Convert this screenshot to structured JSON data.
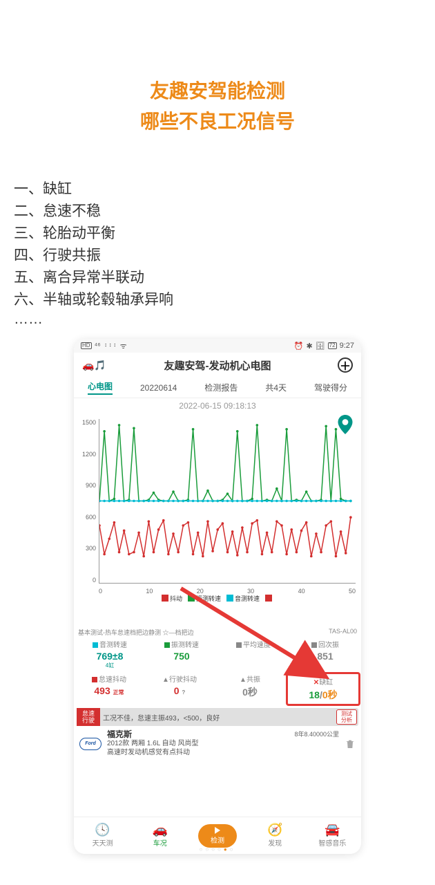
{
  "header": {
    "line1": "友趣安驾能检测",
    "line2": "哪些不良工况信号"
  },
  "items": [
    "一、缺缸",
    "二、怠速不稳",
    "三、轮胎动平衡",
    "四、行驶共振",
    "五、离合异常半联动",
    "六、半轴或轮毂轴承异响"
  ],
  "ellipsis": "……",
  "statusbar": {
    "left": "HD ⁴⁶ ⋮⋮⋮ ᯤ",
    "right": "⏰ ✱ 📶 🔋72 9:27"
  },
  "app": {
    "title": "友趣安驾-发动机心电图"
  },
  "tabs": {
    "t1": "心电图",
    "t2": "20220614",
    "t3": "检测报告",
    "t4": "共4天",
    "t5": "驾驶得分"
  },
  "timestamp": "2022-06-15 09:18:13",
  "chart_data": {
    "type": "line",
    "title": "",
    "xlabel": "",
    "ylabel": "",
    "ylim": [
      0,
      1600
    ],
    "xlim": [
      0,
      52
    ],
    "y_ticks": [
      0,
      300,
      600,
      900,
      1200,
      1500
    ],
    "x_ticks": [
      0,
      10,
      20,
      30,
      40,
      50
    ],
    "series": [
      {
        "name": "抖动",
        "color": "#d32f2f",
        "values": [
          560,
          280,
          430,
          590,
          300,
          510,
          280,
          300,
          490,
          260,
          600,
          300,
          520,
          610,
          280,
          480,
          300,
          560,
          590,
          280,
          490,
          260,
          600,
          310,
          520,
          580,
          300,
          500,
          270,
          540,
          300,
          580,
          610,
          280,
          490,
          300,
          600,
          560,
          280,
          520,
          300,
          510,
          590,
          260,
          480,
          300,
          560,
          600,
          260,
          500,
          290,
          640
        ]
      },
      {
        "name": "振测转速",
        "color": "#1a9c3b",
        "values": [
          800,
          1480,
          800,
          820,
          1540,
          800,
          810,
          1510,
          800,
          800,
          810,
          880,
          810,
          800,
          800,
          890,
          800,
          800,
          810,
          1500,
          800,
          800,
          900,
          800,
          800,
          810,
          870,
          800,
          1480,
          800,
          800,
          820,
          1540,
          800,
          810,
          800,
          920,
          800,
          1500,
          800,
          810,
          800,
          890,
          800,
          800,
          810,
          1530,
          800,
          1500,
          820,
          800,
          800
        ]
      },
      {
        "name": "音测转速",
        "color": "#00bcd4",
        "values": [
          800,
          800,
          800,
          800,
          800,
          800,
          800,
          800,
          800,
          800,
          800,
          800,
          800,
          800,
          800,
          800,
          800,
          800,
          800,
          800,
          800,
          800,
          800,
          800,
          800,
          800,
          800,
          800,
          800,
          800,
          800,
          800,
          800,
          800,
          800,
          800,
          800,
          800,
          800,
          800,
          800,
          800,
          800,
          800,
          800,
          800,
          800,
          800,
          800,
          800,
          800,
          800
        ]
      }
    ],
    "legend": [
      {
        "name": "抖动",
        "color": "#d32f2f"
      },
      {
        "name": "振测转速",
        "color": "#1a9c3b"
      },
      {
        "name": "音测转速",
        "color": "#00bcd4"
      },
      {
        "name": "",
        "color": "#d32f2f"
      }
    ]
  },
  "subnote": {
    "left": "基本测试-热车怠速档把边静测 ☆—档把边",
    "right": "TAS-AL00"
  },
  "metrics": {
    "r1": [
      {
        "lbl": "音测转速",
        "icon": "#00bcd4",
        "val": "769±8",
        "sub": "4缸",
        "valCls": "teal",
        "subCls": "teal"
      },
      {
        "lbl": "振测转速",
        "icon": "#1a9c3b",
        "val": "750",
        "sub": "",
        "valCls": "green"
      },
      {
        "lbl": "平均速度",
        "icon": "#888",
        "val": "",
        "sub": ""
      },
      {
        "lbl": "次振",
        "icon": "#888",
        "val": "851",
        "sub": "",
        "valCls": "gray",
        "prefix": "回"
      }
    ],
    "r2": [
      {
        "lbl": "怠速抖动",
        "icon": "#d32f2f",
        "val": "493",
        "sub": "正常",
        "valCls": "red",
        "subpos": "right"
      },
      {
        "lbl": "行驶抖动",
        "icon": "#333",
        "val": "0",
        "sub": "?",
        "valCls": "red",
        "subCls": "gray",
        "subpos": "right",
        "prelbl": "▲"
      },
      {
        "lbl": "共振",
        "icon": "#333",
        "val": "0秒",
        "valCls": "gray",
        "prelbl": "▲"
      },
      {
        "lbl": "缺缸",
        "icon": "",
        "val_html": true,
        "v1": "18",
        "vsep": "/",
        "v2": "0秒",
        "prelbl": "✕",
        "prelblCls": "x-mark",
        "framed": true
      }
    ]
  },
  "status": {
    "badgeL1": "怠速",
    "badgeL2": "行驶",
    "text": "工况不佳，怠速主振493，<500，良好",
    "rt1": "测试",
    "rt2": "分析"
  },
  "car": {
    "model": "福克斯",
    "desc": "2012款 两厢 1.6L 自动 风尚型",
    "note": "高速时发动机感觉有点抖动",
    "km": "8年8.40000公里"
  },
  "nav": {
    "n1": "天天测",
    "n2": "车况",
    "n3": "检测",
    "n4": "发现",
    "n5": "智感音乐"
  }
}
